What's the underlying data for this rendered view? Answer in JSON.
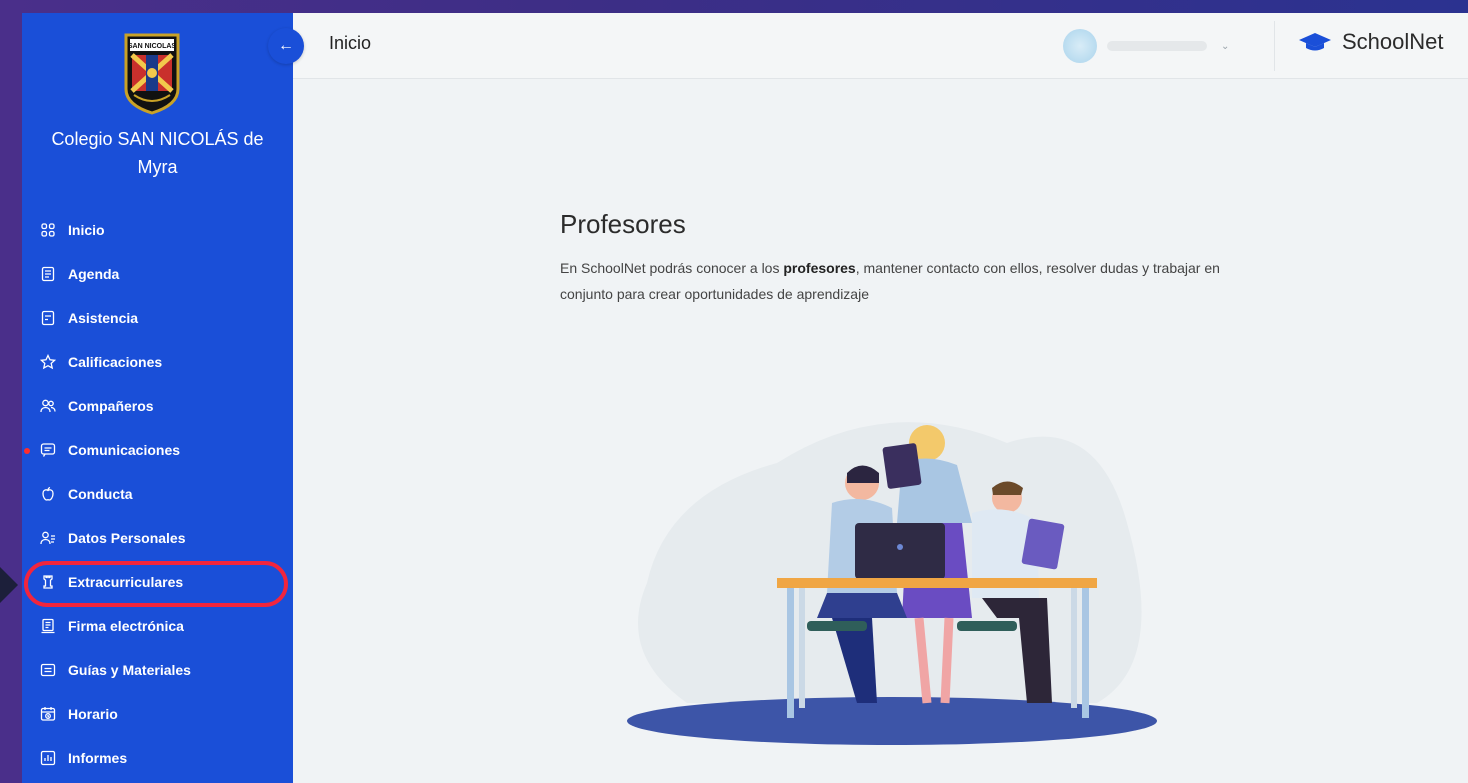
{
  "sidebar": {
    "school_name_line1": "Colegio SAN NICOLÁS de",
    "school_name_line2": "Myra",
    "logo_text": "SAN NICOLAS",
    "items": [
      {
        "label": "Inicio",
        "icon": "grid-icon"
      },
      {
        "label": "Agenda",
        "icon": "notebook-icon"
      },
      {
        "label": "Asistencia",
        "icon": "checklist-icon"
      },
      {
        "label": "Calificaciones",
        "icon": "star-icon"
      },
      {
        "label": "Compañeros",
        "icon": "users-icon"
      },
      {
        "label": "Comunicaciones",
        "icon": "message-icon",
        "notification_dot": true
      },
      {
        "label": "Conducta",
        "icon": "apple-icon"
      },
      {
        "label": "Datos Personales",
        "icon": "user-list-icon"
      },
      {
        "label": "Extracurriculares",
        "icon": "chess-rook-icon",
        "highlighted": true
      },
      {
        "label": "Firma electrónica",
        "icon": "document-sign-icon"
      },
      {
        "label": "Guías y Materiales",
        "icon": "folder-icon"
      },
      {
        "label": "Horario",
        "icon": "calendar-clock-icon"
      },
      {
        "label": "Informes",
        "icon": "bar-chart-icon"
      }
    ],
    "colors": {
      "background": "#1a4fd8",
      "highlight": "#f2253d"
    }
  },
  "header": {
    "title": "Inicio",
    "brand": "SchoolNet",
    "collapse_icon": "arrow-left-icon",
    "user_menu_icon": "chevron-down-icon"
  },
  "main": {
    "title": "Profesores",
    "description_pre": "En SchoolNet podrás conocer a los ",
    "description_bold": "profesores",
    "description_post": ", mantener contacto con ellos, resolver dudas y trabajar en conjunto para crear oportunidades de aprendizaje"
  }
}
